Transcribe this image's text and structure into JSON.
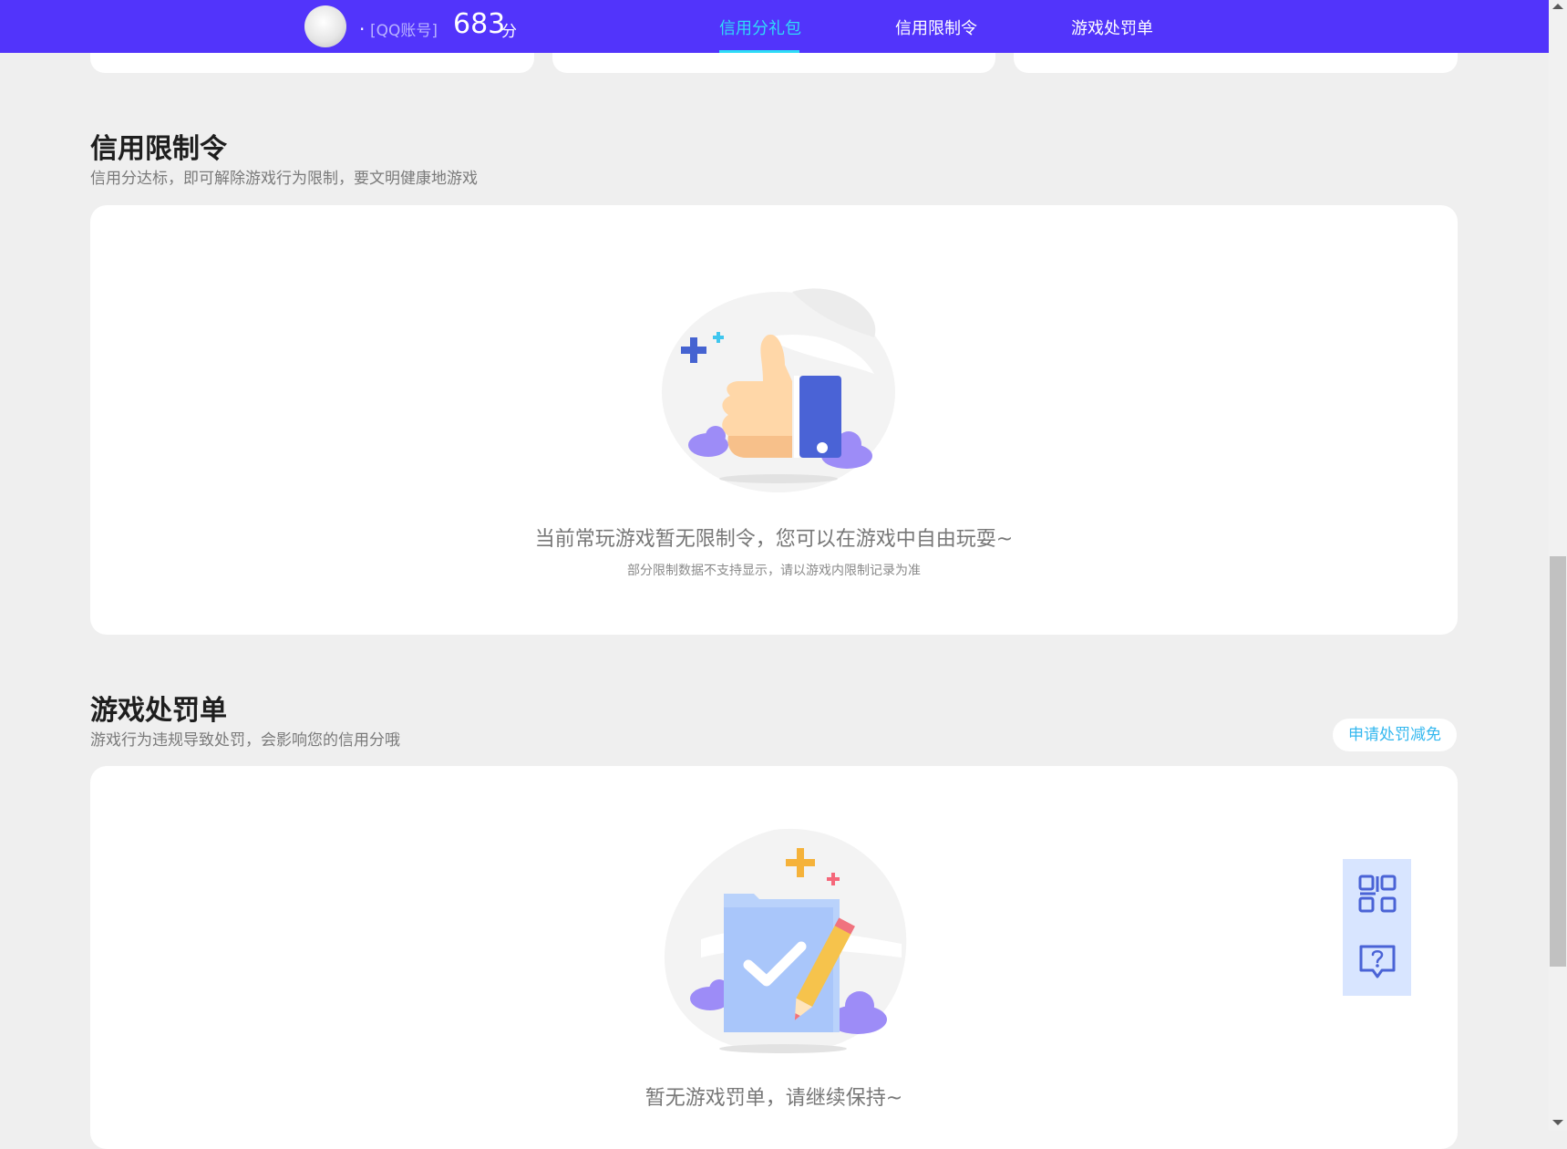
{
  "header": {
    "account_prefix": ".",
    "account_tag": "[QQ账号]",
    "score_value": "683",
    "score_unit": "分",
    "tabs": [
      {
        "label": "信用分礼包",
        "active": true
      },
      {
        "label": "信用限制令",
        "active": false
      },
      {
        "label": "游戏处罚单",
        "active": false
      }
    ]
  },
  "restriction": {
    "title": "信用限制令",
    "subtitle": "信用分达标，即可解除游戏行为限制，要文明健康地游戏",
    "empty_message": "当前常玩游戏暂无限制令，您可以在游戏中自由玩耍~",
    "empty_note": "部分限制数据不支持显示，请以游戏内限制记录为准",
    "illustration_icon": "thumbs-up-icon"
  },
  "penalty": {
    "title": "游戏处罚单",
    "subtitle": "游戏行为违规导致处罚，会影响您的信用分哦",
    "apply_button": "申请处罚减免",
    "empty_message": "暂无游戏罚单，请继续保持~",
    "illustration_icon": "checklist-pencil-icon"
  },
  "floating_tools": [
    {
      "icon": "qr-code-icon"
    },
    {
      "icon": "help-chat-icon"
    }
  ],
  "colors": {
    "header_bg": "#5234fb",
    "active_tab": "#2fdcf7",
    "page_bg": "#efefef",
    "link_blue": "#35b8ef",
    "float_bg": "#d8e5ff",
    "icon_stroke": "#4a63d6"
  }
}
